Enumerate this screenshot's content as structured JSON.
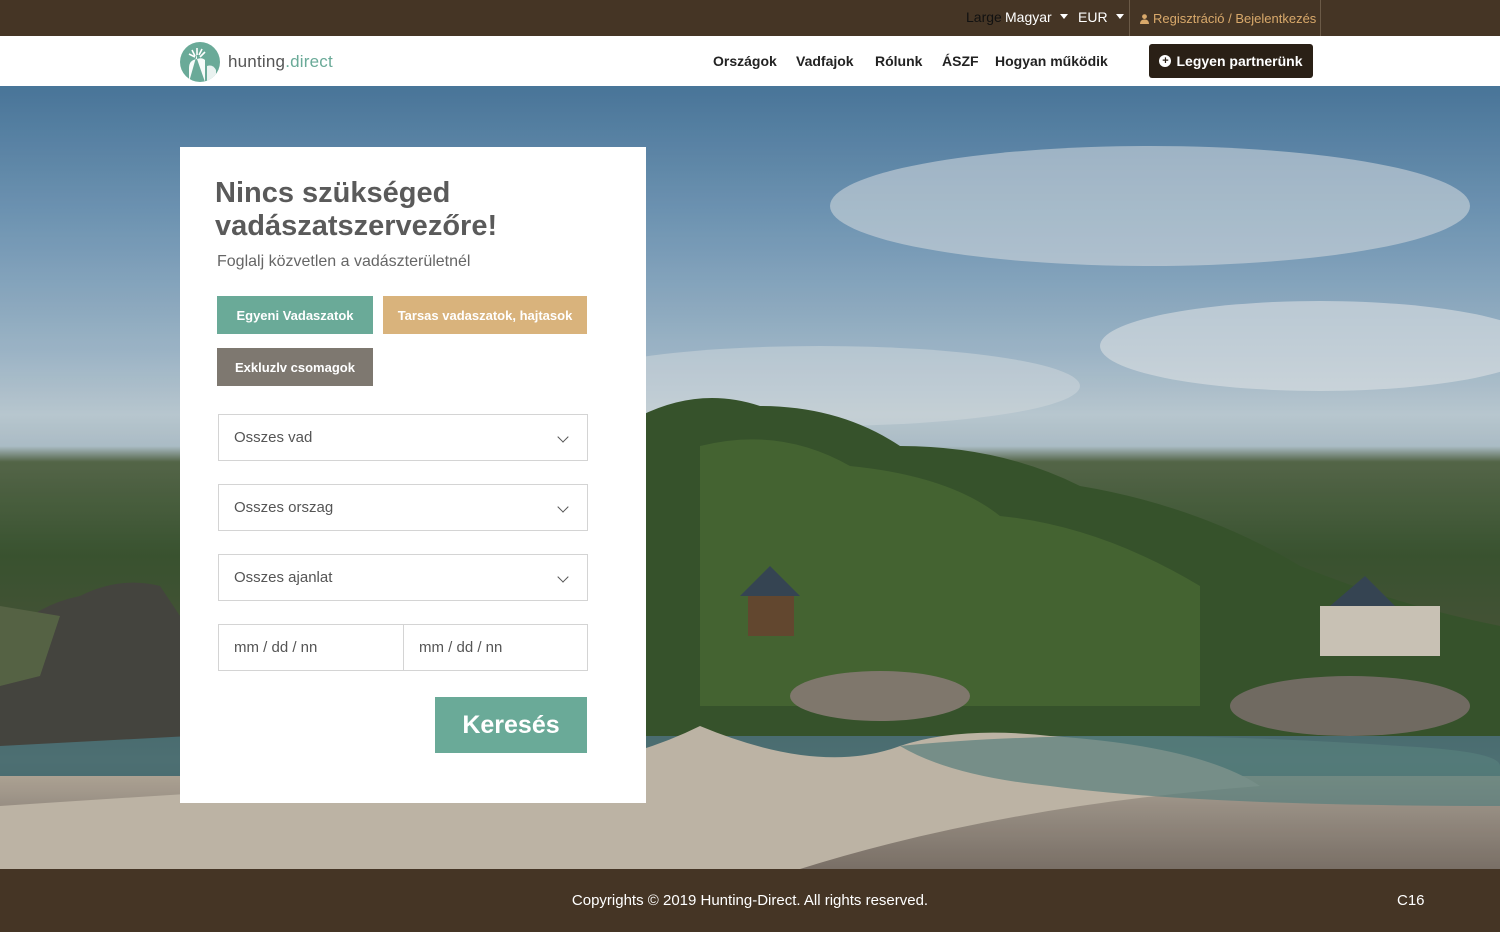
{
  "topbar": {
    "size_label": "Large",
    "language": "Magyar",
    "currency": "EUR",
    "auth_link": "Regisztráció / Bejelentkezés"
  },
  "logo": {
    "name_main": "hunting",
    "name_suffix": ".direct"
  },
  "nav": {
    "items": [
      "Országok",
      "Vadfajok",
      "Rólunk",
      "ÁSZF",
      "Hogyan működik"
    ],
    "partner_button": "Legyen partnerünk"
  },
  "search_card": {
    "title": "Nincs szükséged vadászatszervezőre!",
    "subtitle": "Foglalj közvetlen a vadászterületnél",
    "categories": [
      "Egyeni Vadaszatok",
      "Tarsas vadaszatok, hajtasok",
      "Exkluzlv csomagok"
    ],
    "selects": [
      "Osszes vad",
      "Osszes orszag",
      "Osszes ajanlat"
    ],
    "date_from_placeholder": "mm / dd / nn",
    "date_to_placeholder": "mm / dd / nn",
    "search_button": "Keresés"
  },
  "footer": {
    "copyright": "Copyrights © 2019 Hunting-Direct. All rights reserved.",
    "code": "C16"
  },
  "colors": {
    "brand_dark": "#453525",
    "brand_green": "#6aaa98",
    "tan": "#d9b37c",
    "gray_button": "#7e7870",
    "link_accent": "#d9a96b"
  }
}
